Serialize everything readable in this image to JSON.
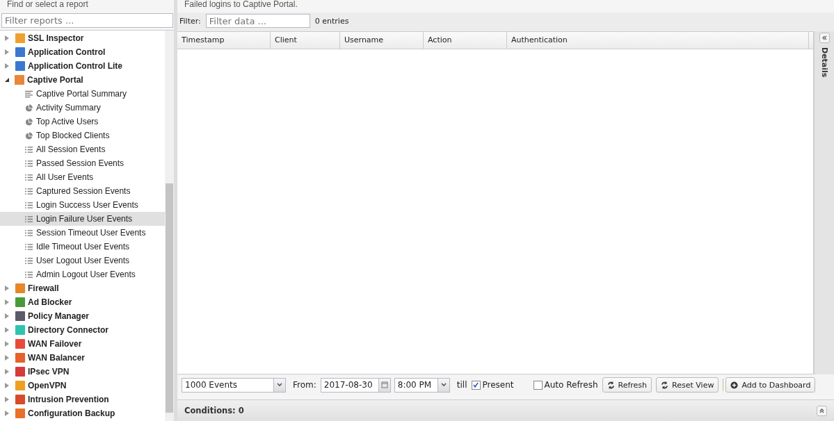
{
  "sidebar": {
    "title": "Find or select a report",
    "filter_placeholder": "Filter reports ...",
    "tree": [
      {
        "label": "SSL Inspector",
        "color": "#f0a030",
        "expanded": false
      },
      {
        "label": "Application Control",
        "color": "#3a78d0",
        "expanded": false
      },
      {
        "label": "Application Control Lite",
        "color": "#3a78d0",
        "expanded": false
      },
      {
        "label": "Captive Portal",
        "color": "#e8863a",
        "expanded": true,
        "children": [
          {
            "label": "Captive Portal Summary",
            "kind": "text",
            "selected": false
          },
          {
            "label": "Activity Summary",
            "kind": "pie",
            "selected": false
          },
          {
            "label": "Top Active Users",
            "kind": "pie",
            "selected": false
          },
          {
            "label": "Top Blocked Clients",
            "kind": "pie",
            "selected": false
          },
          {
            "label": "All Session Events",
            "kind": "list",
            "selected": false
          },
          {
            "label": "Passed Session Events",
            "kind": "list",
            "selected": false
          },
          {
            "label": "All User Events",
            "kind": "list",
            "selected": false
          },
          {
            "label": "Captured Session Events",
            "kind": "list",
            "selected": false
          },
          {
            "label": "Login Success User Events",
            "kind": "list",
            "selected": false
          },
          {
            "label": "Login Failure User Events",
            "kind": "list",
            "selected": true
          },
          {
            "label": "Session Timeout User Events",
            "kind": "list",
            "selected": false
          },
          {
            "label": "Idle Timeout User Events",
            "kind": "list",
            "selected": false
          },
          {
            "label": "User Logout User Events",
            "kind": "list",
            "selected": false
          },
          {
            "label": "Admin Logout User Events",
            "kind": "list",
            "selected": false
          }
        ]
      },
      {
        "label": "Firewall",
        "color": "#e8862a",
        "expanded": false
      },
      {
        "label": "Ad Blocker",
        "color": "#4a9a3a",
        "expanded": false
      },
      {
        "label": "Policy Manager",
        "color": "#5a5a6a",
        "expanded": false
      },
      {
        "label": "Directory Connector",
        "color": "#2ec4b0",
        "expanded": false
      },
      {
        "label": "WAN Failover",
        "color": "#e84a3a",
        "expanded": false
      },
      {
        "label": "WAN Balancer",
        "color": "#e8602a",
        "expanded": false
      },
      {
        "label": "IPsec VPN",
        "color": "#d83a3a",
        "expanded": false
      },
      {
        "label": "OpenVPN",
        "color": "#f0a020",
        "expanded": false
      },
      {
        "label": "Intrusion Prevention",
        "color": "#d84a2a",
        "expanded": false
      },
      {
        "label": "Configuration Backup",
        "color": "#e8702a",
        "expanded": false
      }
    ]
  },
  "report": {
    "description": "Failed logins to Captive Portal.",
    "filter_label": "Filter:",
    "filter_placeholder": "Filter data ...",
    "entries": "0 entries",
    "table": {
      "columns": [
        "Timestamp",
        "Client",
        "Username",
        "Action",
        "Authentication"
      ]
    }
  },
  "toolbar": {
    "limit": "1000 Events",
    "from_label": "From:",
    "date": "2017-08-30",
    "time": "8:00 PM",
    "till_label": "till",
    "present": {
      "label": "Present",
      "checked": true
    },
    "auto_refresh": {
      "label": "Auto Refresh",
      "checked": false
    },
    "buttons": [
      {
        "label": "Refresh",
        "kind": "refresh"
      },
      {
        "label": "Reset View",
        "kind": "refresh"
      },
      {
        "label": "Add to Dashboard",
        "kind": "add"
      }
    ]
  },
  "conditions": "Conditions: 0",
  "details": {
    "title": "Details"
  }
}
